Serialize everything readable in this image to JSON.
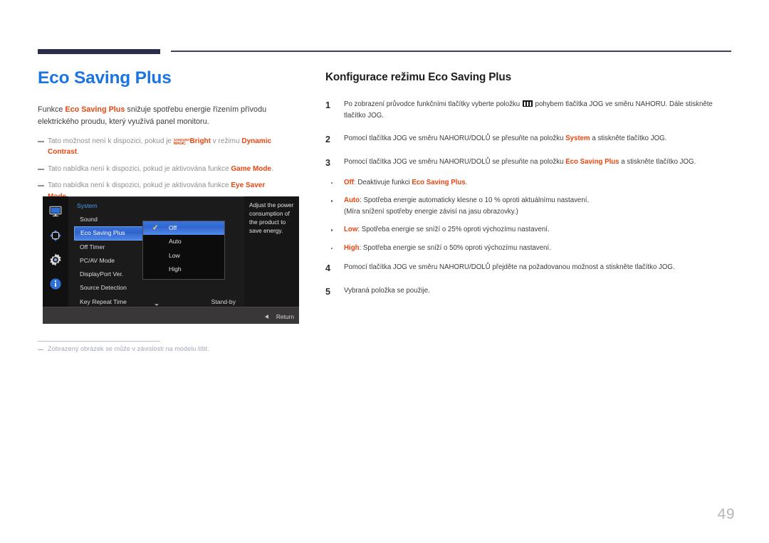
{
  "header": {
    "rule_color": "#2b2d4a"
  },
  "left": {
    "title": "Eco Saving Plus",
    "intro_pre": "Funkce ",
    "intro_kw": "Eco Saving Plus",
    "intro_post": " snižuje spotřebu energie řízením přívodu elektrického proudu, který využívá panel monitoru.",
    "notes": [
      {
        "pre": "Tato možnost není k dispozici, pokud je ",
        "logo_line1": "SAMSUNG",
        "logo_line2": "MAGIC",
        "kw1": "Bright",
        "mid": " v režimu ",
        "kw2": "Dynamic Contrast",
        "post": "."
      },
      {
        "pre": "Tato nabídka není k dispozici, pokud je aktivována funkce ",
        "kw1": "Game Mode",
        "post": "."
      },
      {
        "pre": "Tato nabídka není k dispozici, pokud je aktivována funkce ",
        "kw1": "Eye Saver Mode",
        "post": "."
      }
    ],
    "image_note": "Zobrazený obrázek se může v závislosti na modelu lišit."
  },
  "osd": {
    "rail_icons": [
      {
        "name": "display-icon"
      },
      {
        "name": "move-arrows-icon"
      },
      {
        "name": "gear-icon"
      },
      {
        "name": "info-icon"
      }
    ],
    "section": "System",
    "rows": [
      {
        "label": "Sound",
        "value": "",
        "selected": false
      },
      {
        "label": "Eco Saving Plus",
        "value": "",
        "selected": true
      },
      {
        "label": "Off Timer",
        "value": "",
        "selected": false
      },
      {
        "label": "PC/AV Mode",
        "value": "",
        "selected": false
      },
      {
        "label": "DisplayPort Ver.",
        "value": "",
        "selected": false
      },
      {
        "label": "Source Detection",
        "value": "",
        "selected": false
      },
      {
        "label": "Key Repeat Time",
        "value": "Stand-by",
        "selected": false
      }
    ],
    "submenu": [
      {
        "label": "Off",
        "checked": true,
        "selected": true
      },
      {
        "label": "Auto",
        "checked": false,
        "selected": false
      },
      {
        "label": "Low",
        "checked": false,
        "selected": false
      },
      {
        "label": "High",
        "checked": false,
        "selected": false
      }
    ],
    "check_glyph": "✓",
    "description": "Adjust the power consumption of the product to save energy.",
    "footer_label": "Return"
  },
  "right": {
    "section_title": "Konfigurace režimu Eco Saving Plus",
    "steps": [
      {
        "num": "1",
        "pre": "Po zobrazení průvodce funkčními tlačítky vyberte položku ",
        "has_menu_icon": true,
        "post": " pohybem tlačítka JOG ve směru NAHORU. Dále stiskněte tlačítko JOG."
      },
      {
        "num": "2",
        "pre": "Pomocí tlačítka JOG ve směru NAHORU/DOLŮ se přesuňte na položku ",
        "kw": "System",
        "post": " a stiskněte tlačítko JOG."
      },
      {
        "num": "3",
        "pre": "Pomocí tlačítka JOG ve směru NAHORU/DOLŮ se přesuňte na položku ",
        "kw": "Eco Saving Plus",
        "post": " a stiskněte tlačítko JOG."
      }
    ],
    "bullets": [
      {
        "kw": "Off",
        "text": ": Deaktivuje funkci ",
        "kw2": "Eco Saving Plus",
        "post": "."
      },
      {
        "kw": "Auto",
        "text": ": Spotřeba energie automaticky klesne o 10 % oproti aktuálnímu nastavení.",
        "line2": "(Míra snížení spotřeby energie závisí na jasu obrazovky.)"
      },
      {
        "kw": "Low",
        "text": ": Spotřeba energie se sníží o 25% oproti výchozímu nastavení."
      },
      {
        "kw": "High",
        "text": ": Spotřeba energie se sníží o 50% oproti výchozímu nastavení."
      }
    ],
    "steps_tail": [
      {
        "num": "4",
        "pre": "Pomocí tlačítka JOG ve směru NAHORU/DOLŮ přejděte na požadovanou možnost a stiskněte tlačítko JOG."
      },
      {
        "num": "5",
        "pre": "Vybraná položka se použije."
      }
    ]
  },
  "footer": {
    "page_number": "49"
  }
}
